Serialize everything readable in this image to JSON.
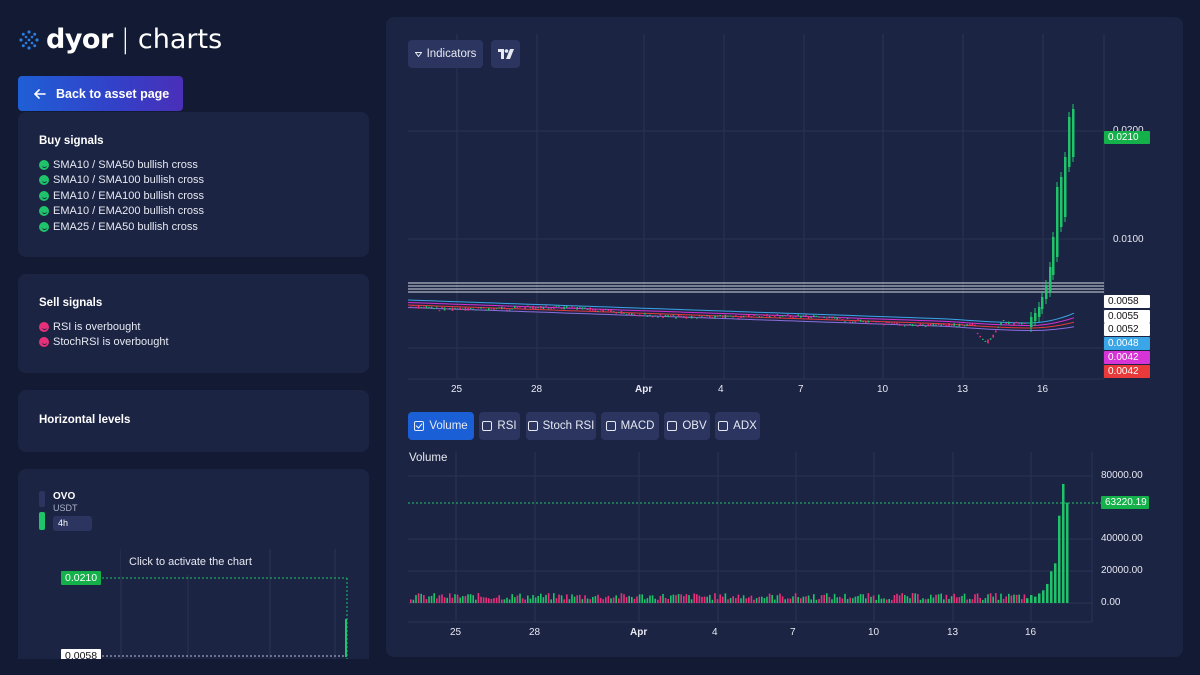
{
  "brand": {
    "name_bold": "dyor",
    "separator": "|",
    "name_light": "charts"
  },
  "back_button": {
    "label": "Back to asset page",
    "icon": "arrow-left-icon"
  },
  "buy_signals": {
    "title": "Buy signals",
    "items": [
      "SMA10 / SMA50 bullish cross",
      "SMA10 / SMA100 bullish cross",
      "EMA10 / EMA100 bullish cross",
      "EMA10 / EMA200 bullish cross",
      "EMA25 / EMA50 bullish cross"
    ]
  },
  "sell_signals": {
    "title": "Sell signals",
    "items": [
      "RSI is overbought",
      "StochRSI is overbought"
    ]
  },
  "horizontal_levels": {
    "title": "Horizontal levels"
  },
  "mini_chart": {
    "symbol": "OVO",
    "quote": "USDT",
    "interval": "4h",
    "overlay_text": "Click to activate the chart",
    "price_label": "0.0210",
    "level_label": "0.0058"
  },
  "toolbar": {
    "indicators_label": "Indicators",
    "tv_icon": "tradingview-logo-icon"
  },
  "price_axis": {
    "ticks": [
      "0.0200",
      "0.0100"
    ],
    "labels": [
      {
        "text": "0.0210",
        "color": "#14b04a"
      },
      {
        "text": "0.0058",
        "color": "#ffffff"
      },
      {
        "text": "0.0055",
        "color": "#ffffff"
      },
      {
        "text": "0.0052",
        "color": "#ffffff"
      },
      {
        "text": "0.0048",
        "color": "#3aa6e8"
      },
      {
        "text": "0.0042",
        "color": "#d634d6"
      },
      {
        "text": "0.0042",
        "color": "#e83a3a"
      }
    ]
  },
  "x_axis": {
    "labels": [
      "25",
      "28",
      "Apr",
      "4",
      "7",
      "10",
      "13",
      "16"
    ]
  },
  "indicator_tabs": [
    {
      "label": "Volume",
      "checked": true
    },
    {
      "label": "RSI",
      "checked": false
    },
    {
      "label": "Stoch RSI",
      "checked": false
    },
    {
      "label": "MACD",
      "checked": false
    },
    {
      "label": "OBV",
      "checked": false
    },
    {
      "label": "ADX",
      "checked": false
    }
  ],
  "volume_panel": {
    "title": "Volume",
    "ticks": [
      "80000.00",
      "40000.00",
      "20000.00",
      "0.00"
    ],
    "last_label": "63220.19",
    "last_color": "#14b04a"
  },
  "colors": {
    "up": "#1fc36a",
    "down": "#e8307a",
    "bg": "#1c2443",
    "page": "#131a33"
  },
  "chart_data": {
    "type": "candlestick",
    "price_recent": [
      0.0052,
      0.005,
      0.0048,
      0.0046,
      0.0044,
      0.0043,
      0.0042,
      0.0045,
      0.0047,
      0.0052,
      0.0065,
      0.0085,
      0.012,
      0.015,
      0.019,
      0.021
    ],
    "volume_recent": [
      3000,
      5000,
      4000,
      6000,
      8000,
      12000,
      20000,
      25000,
      55000,
      75000,
      63220.19
    ]
  }
}
